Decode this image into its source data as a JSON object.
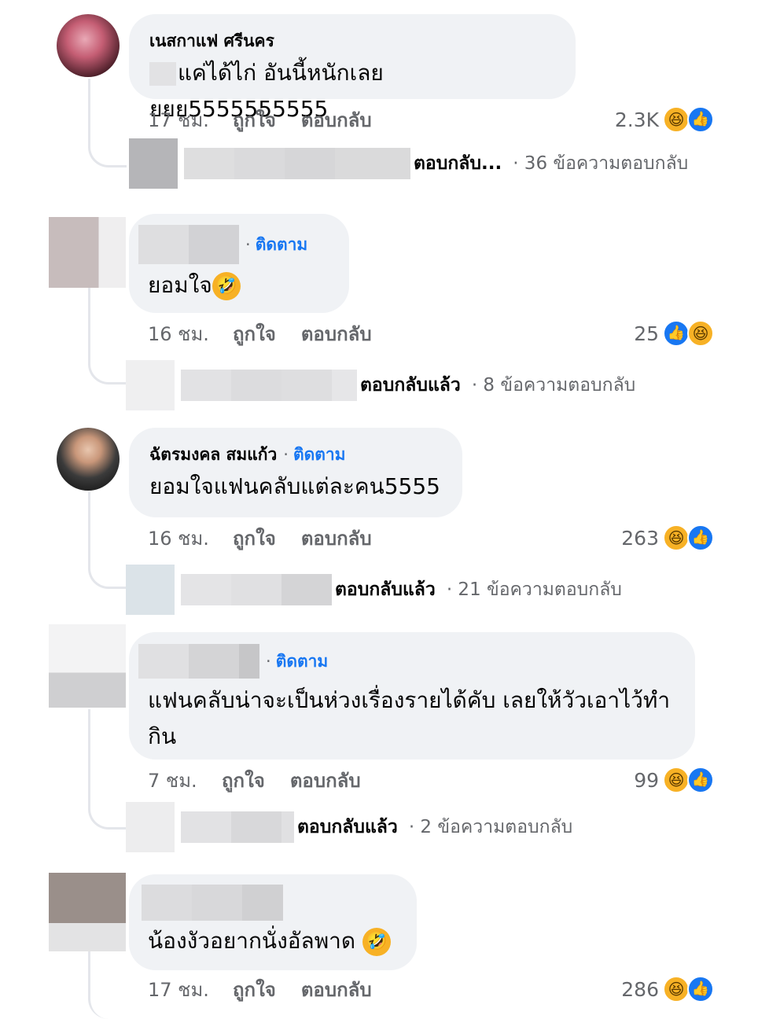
{
  "comments": [
    {
      "author": "เนสกาแฟ ศรีนคร",
      "follow": "",
      "text": "แค่ได้ไก่ อันนี้หนักเลยยยย5555555555",
      "time": "17 ชม.",
      "like_label": "ถูกใจ",
      "reply_label": "ตอบกลับ",
      "reaction_count": "2.3K",
      "reactions": [
        "haha",
        "like"
      ],
      "replies": {
        "label": "ตอบกลับ...",
        "count_text": "· 36 ข้อความตอบกลับ"
      }
    },
    {
      "author": "",
      "follow": "ติดตาม",
      "text": "ยอมใจ",
      "time": "16 ชม.",
      "like_label": "ถูกใจ",
      "reply_label": "ตอบกลับ",
      "reaction_count": "25",
      "reactions": [
        "like",
        "haha"
      ],
      "replies": {
        "label": "ตอบกลับแล้ว",
        "count_text": "· 8 ข้อความตอบกลับ"
      }
    },
    {
      "author": "ฉัตรมงคล สมแก้ว",
      "follow": "ติดตาม",
      "text": "ยอมใจแฟนคลับแต่ละคน5555",
      "time": "16 ชม.",
      "like_label": "ถูกใจ",
      "reply_label": "ตอบกลับ",
      "reaction_count": "263",
      "reactions": [
        "haha",
        "like"
      ],
      "replies": {
        "label": "ตอบกลับแล้ว",
        "count_text": "· 21 ข้อความตอบกลับ"
      }
    },
    {
      "author": "",
      "follow": "ติดตาม",
      "text": "แฟนคลับน่าจะเป็นห่วงเรื่องรายได้คับ เลยให้วัวเอาไว้ทำกิน",
      "time": "7 ชม.",
      "like_label": "ถูกใจ",
      "reply_label": "ตอบกลับ",
      "reaction_count": "99",
      "reactions": [
        "haha",
        "like"
      ],
      "replies": {
        "label": "ตอบกลับแล้ว",
        "count_text": "· 2 ข้อความตอบกลับ"
      }
    },
    {
      "author": "",
      "follow": "",
      "text": "น้องงัวอยากนั่งอัลพาด",
      "time": "17 ชม.",
      "like_label": "ถูกใจ",
      "reply_label": "ตอบกลับ",
      "reaction_count": "286",
      "reactions": [
        "haha",
        "like"
      ]
    }
  ],
  "colors": {
    "bubble": "#f0f2f5",
    "link": "#1877f2",
    "meta": "#65676b",
    "haha": "#f7b125",
    "like": "#1877f2"
  },
  "icons": {
    "haha": "haha-reaction-icon",
    "like": "like-reaction-icon",
    "rofl": "rofl-emoji-icon"
  }
}
